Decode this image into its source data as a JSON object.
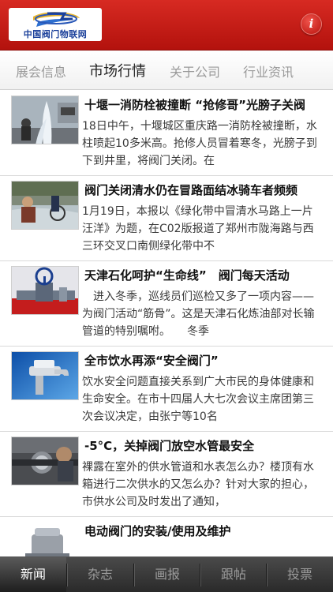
{
  "header": {
    "logo_text": "中国阀门物联网",
    "info_label": "i"
  },
  "tabs": [
    {
      "label": "展会信息",
      "active": false
    },
    {
      "label": "市场行情",
      "active": true
    },
    {
      "label": "关于公司",
      "active": false
    },
    {
      "label": "行业资讯",
      "active": false
    }
  ],
  "articles": [
    {
      "title": "十堰一消防栓被撞断 “抢修哥”光膀子关阀",
      "summary": "18日中午，十堰城区重庆路一消防栓被撞断，水柱喷起10多米高。抢修人员冒着寒冬，光膀子到下到井里，将阀门关闭。在",
      "thumb_icon": "water-fountain-photo-icon"
    },
    {
      "title": "阀门关闭清水仍在冒路面结冰骑车者频频",
      "summary": "1月19日，本报以《绿化带中冒清水马路上一片汪洋》为题，在C02版报道了郑州市陇海路与西三环交叉口南侧绿化带中不",
      "thumb_icon": "flooded-road-photo-icon"
    },
    {
      "title": "天津石化呵护“生命线”　阀门每天活动",
      "summary": "　进入冬季，巡线员们巡检又多了一项内容——为阀门活动“筋骨”。这是天津石化炼油部对长输管道的特别嘱咐。　　冬季",
      "thumb_icon": "valve-photo-icon"
    },
    {
      "title": "全市饮水再添“安全阀门”",
      "summary": "饮水安全问题直接关系到广大市民的身体健康和生命安全。在市十四届人大七次会议主席团第三次会议决定，由张宁等10名",
      "thumb_icon": "faucet-photo-icon"
    },
    {
      "title": "-5°C，关掉阀门放空水管最安全",
      "summary": "裸露在室外的供水管道和水表怎么办？楼顶有水箱进行二次供水的又怎么办？针对大家的担心，市供水公司及时发出了通知，",
      "thumb_icon": "water-meter-photo-icon"
    },
    {
      "title": "电动阀门的安装/使用及维护",
      "summary": "",
      "thumb_icon": "electric-valve-photo-icon"
    }
  ],
  "tabbar": [
    {
      "label": "新闻",
      "active": true
    },
    {
      "label": "杂志",
      "active": false
    },
    {
      "label": "画报",
      "active": false
    },
    {
      "label": "跟帖",
      "active": false
    },
    {
      "label": "投票",
      "active": false
    }
  ],
  "colors": {
    "header_red": "#c41a14",
    "logo_blue": "#1a3f9a",
    "tabbar_dark": "#2a2a2a"
  }
}
